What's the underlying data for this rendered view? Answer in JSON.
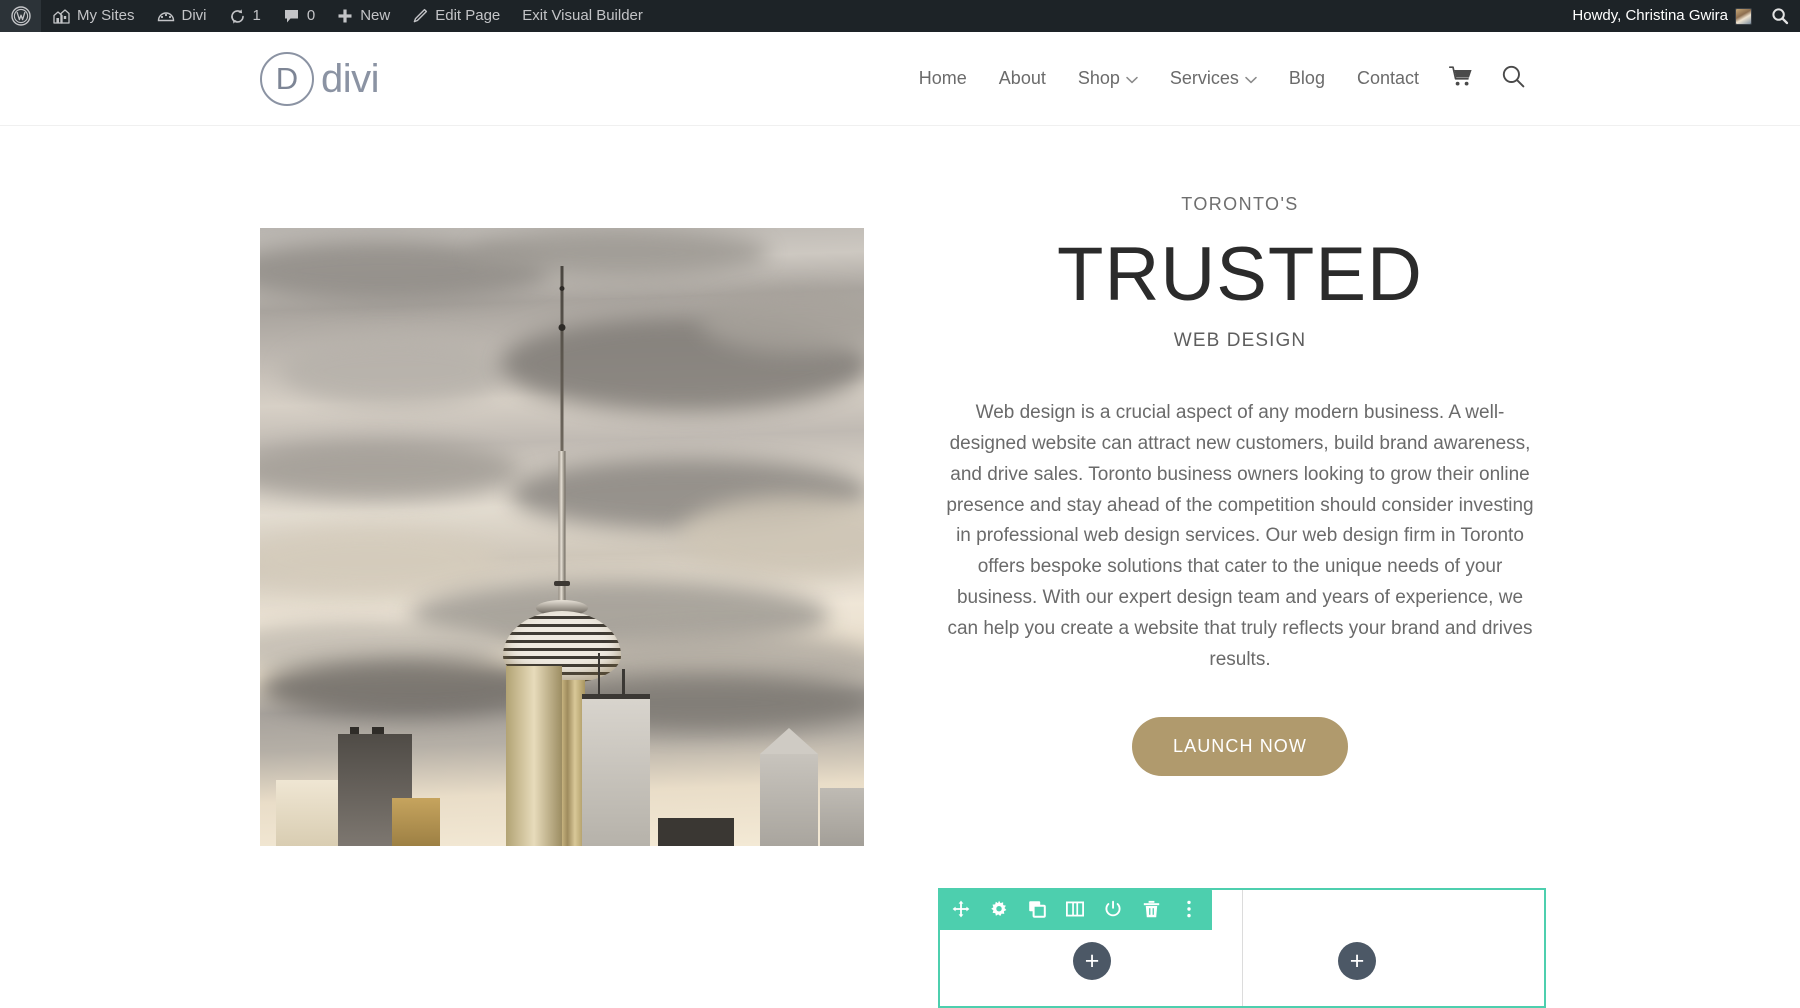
{
  "admin_bar": {
    "left_items": [
      {
        "icon": "wordpress-logo-icon",
        "label": ""
      },
      {
        "icon": "my-sites-icon",
        "label": "My Sites"
      },
      {
        "icon": "divi-dashboard-icon",
        "label": "Divi"
      },
      {
        "icon": "updates-icon",
        "label": "1"
      },
      {
        "icon": "comments-icon",
        "label": "0"
      },
      {
        "icon": "plus-icon",
        "label": "New"
      },
      {
        "icon": "pencil-icon",
        "label": "Edit Page"
      },
      {
        "icon": "",
        "label": "Exit Visual Builder"
      }
    ],
    "howdy": "Howdy, Christina Gwira",
    "search_icon": "search-icon"
  },
  "site_header": {
    "logo": {
      "mark": "D",
      "word": "divi"
    },
    "nav": [
      {
        "label": "Home",
        "has_dropdown": false
      },
      {
        "label": "About",
        "has_dropdown": false
      },
      {
        "label": "Shop",
        "has_dropdown": true
      },
      {
        "label": "Services",
        "has_dropdown": true
      },
      {
        "label": "Blog",
        "has_dropdown": false
      },
      {
        "label": "Contact",
        "has_dropdown": false
      }
    ],
    "cart_icon": "shopping-cart-icon",
    "search_icon": "search-icon"
  },
  "hero": {
    "eyebrow": "TORONTO'S",
    "headline": "TRUSTED",
    "subhead": "WEB DESIGN",
    "paragraph": "Web design is a crucial aspect of any modern business. A well-designed website can attract new customers, build brand awareness, and drive sales. Toronto business owners looking to grow their online presence and stay ahead of the competition should consider investing in professional web design services. Our web design firm in Toronto offers bespoke solutions that cater to the unique needs of your business. With our expert design team and years of experience, we can help you create a website that truly reflects your brand and drives results.",
    "cta_label": "LAUNCH NOW",
    "image_alt": "CN Tower Toronto skyline"
  },
  "builder": {
    "toolbar_buttons": [
      {
        "name": "move-row",
        "icon": "move-icon"
      },
      {
        "name": "row-settings",
        "icon": "gear-icon"
      },
      {
        "name": "duplicate-row",
        "icon": "duplicate-icon"
      },
      {
        "name": "column-structure",
        "icon": "columns-icon"
      },
      {
        "name": "disable-row",
        "icon": "power-icon"
      },
      {
        "name": "delete-row",
        "icon": "trash-icon"
      },
      {
        "name": "more-options",
        "icon": "kebab-menu-icon"
      }
    ],
    "section_menu_icon": "three-dots-icon",
    "add_module_label": "+"
  },
  "colors": {
    "admin_bar_bg": "#1d2327",
    "builder_teal": "#4dcfae",
    "builder_purple": "#7231dc",
    "add_module_gray": "#4c5866",
    "cta_tan": "#b09a6d",
    "logo_gray": "#8b93a3"
  }
}
